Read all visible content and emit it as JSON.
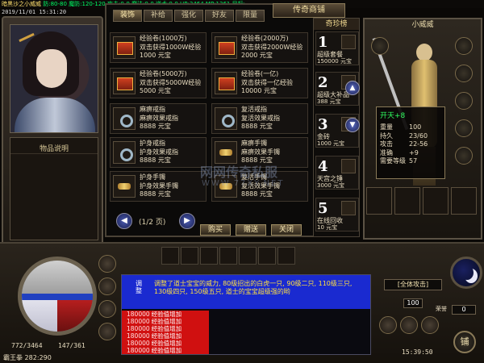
{
  "topbar": {
    "name": "暗黑沙之小威威",
    "stats": "防:80-80 魔防:120-120 攻击:0-0 魔法:0-0 道术:0-0 HP:3464 MP:1361 目标:",
    "timestamp": "2019/11/01 15:31:20"
  },
  "left_panel": {
    "desc_title": "物品说明"
  },
  "shop": {
    "tabs": [
      "装饰",
      "补给",
      "强化",
      "好友",
      "限量"
    ],
    "title": "传奇商铺",
    "items": [
      {
        "lines": [
          "经验卷(1000万)",
          "双击获得1000W经验",
          "1000 元宝"
        ],
        "icon": "scroll-icon"
      },
      {
        "lines": [
          "经验卷(2000万)",
          "双击获得2000W经验",
          "2000 元宝"
        ],
        "icon": "scroll-icon"
      },
      {
        "lines": [
          "经验卷(5000万)",
          "双击获得5000W经验",
          "5000 元宝"
        ],
        "icon": "scroll-icon"
      },
      {
        "lines": [
          "经验卷(一亿)",
          "双击获得一亿经验",
          "10000 元宝"
        ],
        "icon": "scroll-icon"
      },
      {
        "lines": [
          "麻痹戒指",
          "麻痹效果戒指",
          "8888 元宝"
        ],
        "icon": "ring-icon"
      },
      {
        "lines": [
          "复活戒指",
          "复活效果戒指",
          "8888 元宝"
        ],
        "icon": "ring-icon"
      },
      {
        "lines": [
          "护身戒指",
          "护身效果戒指",
          "8888 元宝"
        ],
        "icon": "ring-icon"
      },
      {
        "lines": [
          "麻痹手镯",
          "麻痹效果手镯",
          "8888 元宝"
        ],
        "icon": "bracelet-icon"
      },
      {
        "lines": [
          "护身手镯",
          "护身效果手镯",
          "8888 元宝"
        ],
        "icon": "bracelet-icon"
      },
      {
        "lines": [
          "复活手镯",
          "复活效果手镯",
          "8888 元宝"
        ],
        "icon": "bracelet-icon"
      }
    ],
    "page": "(1/2 页)",
    "buttons": {
      "buy": "购买",
      "gift": "赠送",
      "close": "关闭"
    }
  },
  "rare": {
    "title": "奇珍榜",
    "items": [
      {
        "num": "1",
        "name": "超级套餐",
        "price": "150000 元宝"
      },
      {
        "num": "2",
        "name": "超级大补品",
        "price": "388 元宝"
      },
      {
        "num": "3",
        "name": "金砖",
        "price": "1000 元宝"
      },
      {
        "num": "4",
        "name": "天宫之锤",
        "price": "3000 元宝"
      },
      {
        "num": "5",
        "name": "在线回收",
        "price": "10 元宝"
      }
    ]
  },
  "character": {
    "name": "小威威",
    "tooltip": {
      "title": "开天+8",
      "rows": [
        {
          "k": "重量",
          "v": "100"
        },
        {
          "k": "持久",
          "v": "23/60"
        },
        {
          "k": "攻击",
          "v": "22-56"
        },
        {
          "k": "准确",
          "v": "+9"
        },
        {
          "k": "需要等级",
          "v": "57"
        }
      ]
    }
  },
  "watermark": {
    "line1": "网网传奇私服",
    "line2": "WWW.77XY.NET"
  },
  "hud": {
    "hp": "772/3464",
    "mp": "147/361",
    "player": "霸王拳",
    "coords": "282:290",
    "hp_fraction": 0.22,
    "system_label": "调整",
    "system_msg": "调整了道士宝宝的威力, 80级招出的白虎一只, 90级二只, 110级三只, 130级四只, 150级五只, 道士的宝宝超级强的哟",
    "chat_lines": [
      {
        "val": "180000",
        "txt": "经验值增加"
      },
      {
        "val": "180000",
        "txt": "经验值增加"
      },
      {
        "val": "180000",
        "txt": "经验值增加"
      },
      {
        "val": "180000",
        "txt": "经验值增加"
      },
      {
        "val": "180000",
        "txt": "经验值增加"
      },
      {
        "val": "180000",
        "txt": "经验值增加"
      }
    ],
    "attack_mode": "[全体攻击]",
    "speed": "100",
    "honor_label": "荣誉",
    "honor_value": "0",
    "clock": "15:39:50",
    "shop_btn": "铺"
  }
}
